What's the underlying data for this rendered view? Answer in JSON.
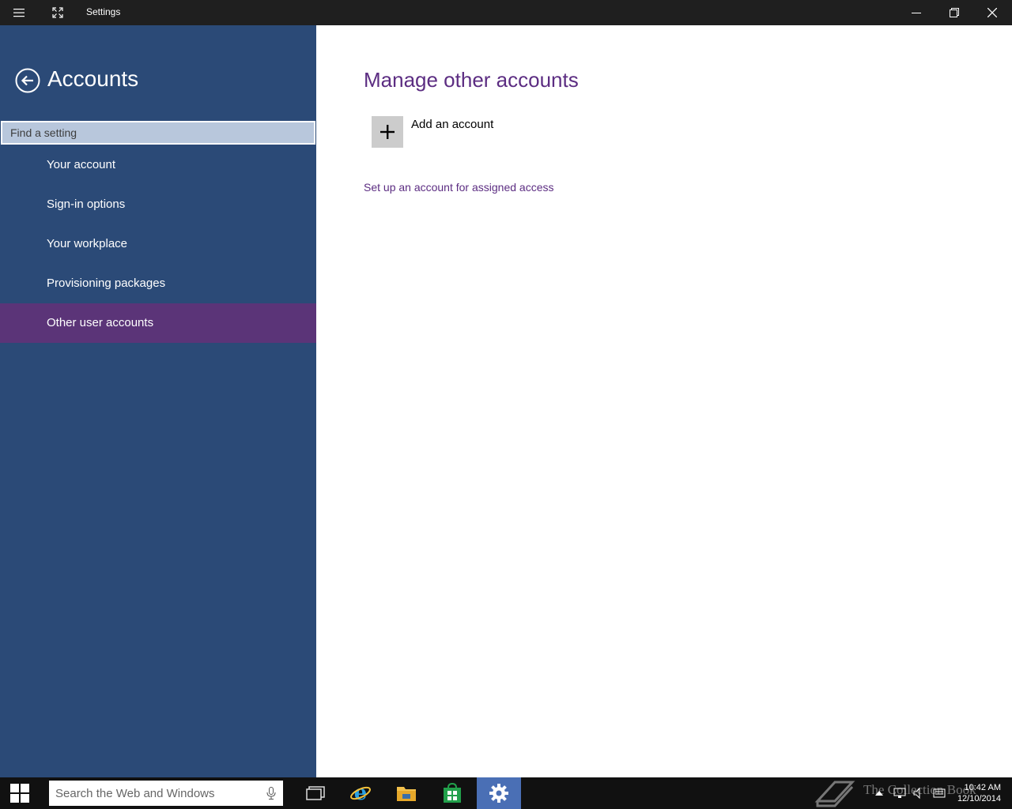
{
  "window": {
    "title": "Settings"
  },
  "sidebar": {
    "title": "Accounts",
    "search_placeholder": "Find a setting",
    "items": [
      {
        "label": "Your account"
      },
      {
        "label": "Sign-in options"
      },
      {
        "label": "Your workplace"
      },
      {
        "label": "Provisioning packages"
      },
      {
        "label": "Other user accounts",
        "active": true
      }
    ]
  },
  "main": {
    "title": "Manage other accounts",
    "add_account_label": "Add an account",
    "assigned_access_link": "Set up an account for assigned access"
  },
  "taskbar": {
    "search_placeholder": "Search the Web and Windows",
    "watermark_text": "The Collection Book",
    "time": "10:42 AM",
    "date": "12/10/2014",
    "apps": [
      "task-view",
      "internet-explorer",
      "file-explorer",
      "store",
      "settings"
    ]
  },
  "colors": {
    "sidebar_bg": "#2b4a77",
    "active_item_bg": "#5b3478",
    "accent_purple": "#5c2d82",
    "titlebar_bg": "#1f1f1f",
    "taskbar_bg": "#111111",
    "taskbar_active": "#4a6fb5"
  }
}
